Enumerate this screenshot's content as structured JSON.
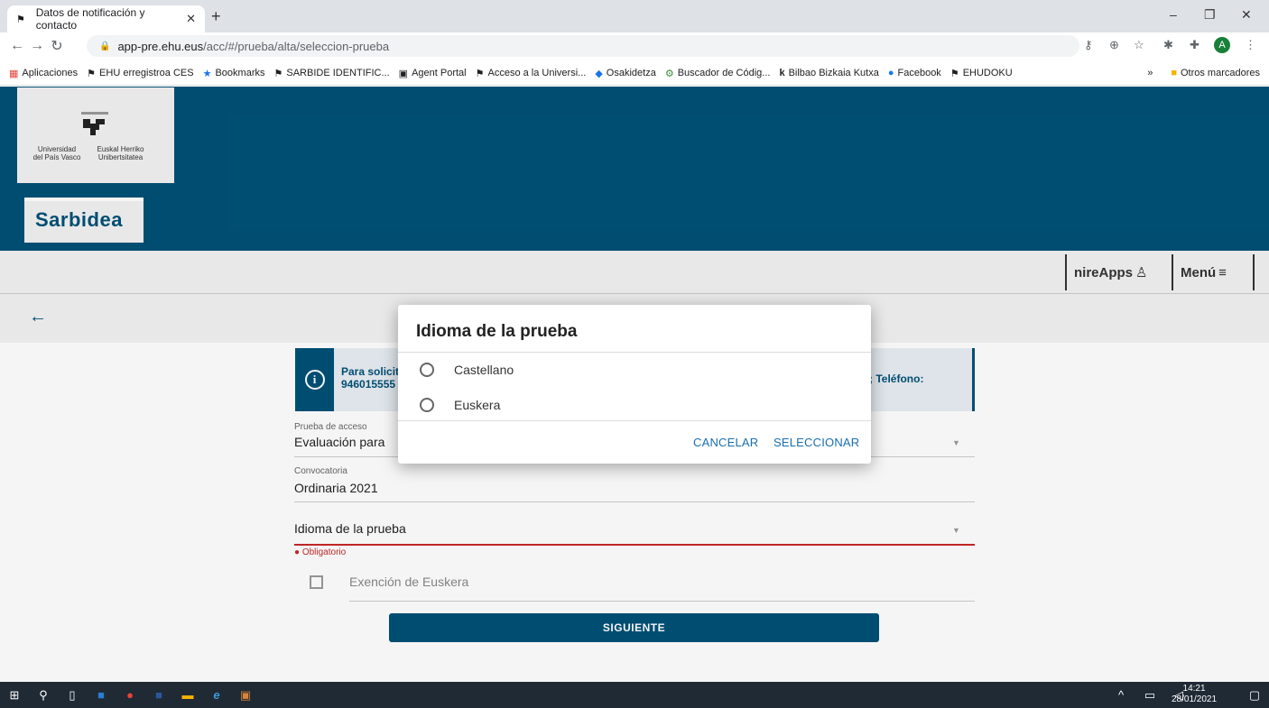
{
  "browser": {
    "tab_title": "Datos de notificación y contacto",
    "tab_close": "✕",
    "new_tab": "+",
    "url_host": "app-pre.ehu.eus",
    "url_path": "/acc/#/prueba/alta/seleccion-prueba",
    "bookmarks": [
      {
        "label": "Aplicaciones",
        "icon": "apps-grid-icon"
      },
      {
        "label": "EHU erregistroa CES",
        "icon": "ehu-icon"
      },
      {
        "label": "Bookmarks",
        "icon": "star-icon"
      },
      {
        "label": "SARBIDE IDENTIFIC...",
        "icon": "ehu-icon"
      },
      {
        "label": "Agent Portal",
        "icon": "portal-icon"
      },
      {
        "label": "Acceso a la Universi...",
        "icon": "ehu-icon"
      },
      {
        "label": "Osakidetza",
        "icon": "osakidetza-icon"
      },
      {
        "label": "Buscador de Códig...",
        "icon": "search-code-icon"
      },
      {
        "label": "Bilbao Bizkaia Kutxa",
        "icon": "k-icon"
      },
      {
        "label": "Facebook",
        "icon": "facebook-icon"
      },
      {
        "label": "EHUDOKU",
        "icon": "ehu-icon"
      }
    ],
    "more_bookmarks": "»",
    "other_bookmarks": "Otros marcadores",
    "avatar_letter": "A"
  },
  "header": {
    "logo_left": "Universidad\ndel País Vasco",
    "logo_right": "Euskal Herriko\nUnibertsitatea",
    "app_title": "Sarbidea",
    "nireapps_label": "nireApps",
    "menu_label": "Menú"
  },
  "info": {
    "text_line1": "Para solicit",
    "text_line2": "946015555",
    "text_right": "; Teléfono:"
  },
  "form": {
    "prueba_label": "Prueba de acceso",
    "prueba_value": "Evaluación para",
    "convocatoria_label": "Convocatoria",
    "convocatoria_value": "Ordinaria 2021",
    "idioma_placeholder": "Idioma de la prueba",
    "required_msg": "Obligatorio",
    "exencion_label": "Exención de Euskera",
    "next_button": "SIGUIENTE"
  },
  "dialog": {
    "title": "Idioma de la prueba",
    "options": [
      "Castellano",
      "Euskera"
    ],
    "cancel_label": "CANCELAR",
    "select_label": "SELECCIONAR"
  },
  "taskbar": {
    "time": "14:21",
    "date": "28/01/2021"
  },
  "colors": {
    "brand": "#005177",
    "error": "#c62828",
    "dialog_button": "#1a6fb0"
  }
}
